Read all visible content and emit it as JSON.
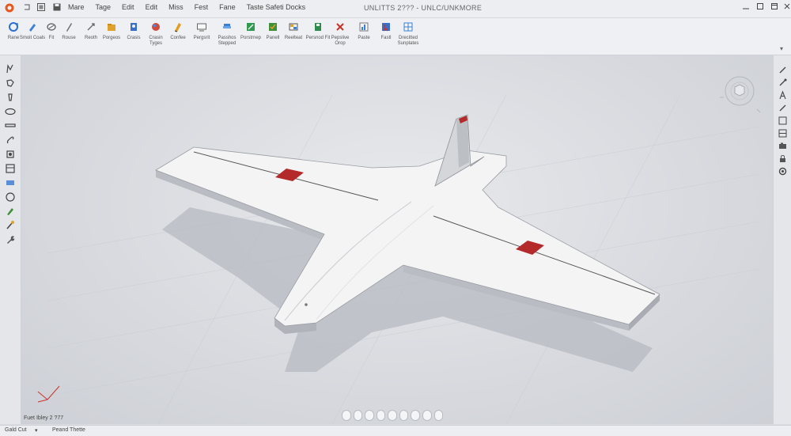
{
  "titlebar": {
    "menus": [
      "Mare",
      "Tage",
      "Edit",
      "Edit",
      "Miss",
      "Fest",
      "Fane",
      "Taste Safeti Docks"
    ],
    "title": "UNLITTS 2??? - UNLC/UNKMORE"
  },
  "ribbon": {
    "buttons": [
      {
        "label": "Rane",
        "icon": "circle-arrow-icon"
      },
      {
        "label": "Smoit Coals",
        "icon": "pencil-icon"
      },
      {
        "label": "Fit",
        "icon": "loop-icon"
      },
      {
        "label": "Rouse",
        "icon": "pen-icon"
      },
      {
        "label": "Reoth",
        "icon": "move-icon"
      },
      {
        "label": "Porgeos",
        "icon": "folder-icon"
      },
      {
        "label": "Crasis",
        "icon": "user-icon"
      },
      {
        "label": "Crasin Tyges",
        "icon": "globe-icon"
      },
      {
        "label": "Confee",
        "icon": "sketch-icon"
      },
      {
        "label": "Pergsrit",
        "icon": "screen-icon"
      },
      {
        "label": "Passhos Stepped",
        "icon": "layers-icon"
      },
      {
        "label": "Porstrnep",
        "icon": "cube-icon"
      },
      {
        "label": "Panell",
        "icon": "check-icon"
      },
      {
        "label": "Reelteat",
        "icon": "image-icon"
      },
      {
        "label": "Persnod Fit",
        "icon": "save-icon"
      },
      {
        "label": "Pepslive Orop",
        "icon": "close-icon"
      },
      {
        "label": "Paste",
        "icon": "chart-icon"
      },
      {
        "label": "Fastl",
        "icon": "cursor-icon"
      },
      {
        "label": "Drecitted Sunplates",
        "icon": "grid-icon"
      }
    ]
  },
  "viewport": {
    "label": "Fuet Ibley 2 ?77"
  },
  "status": {
    "left": "Gald Cut",
    "middle": "Peand Thette"
  },
  "colors": {
    "accent": "#2b6fd1",
    "marker": "#b42a2a"
  }
}
